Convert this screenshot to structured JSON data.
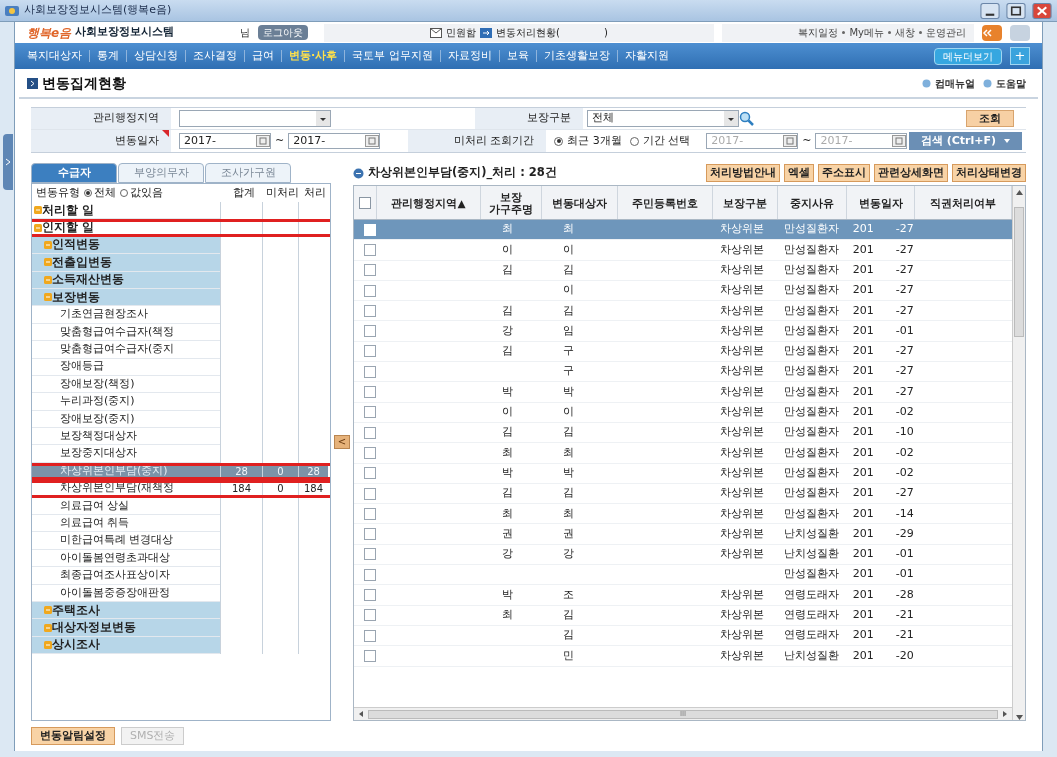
{
  "window": {
    "title": "사회보장정보시스템(행복e음)"
  },
  "header": {
    "logo_mark": "행복e음",
    "logo_text": "사회보장정보시스템",
    "user_suffix": "님",
    "logout": "로그아웃",
    "inbox": "민원함",
    "status_prefix": "변동처리현황(",
    "status_suffix": ")",
    "links": [
      "복지일정",
      "My메뉴",
      "새창",
      "운영관리"
    ]
  },
  "nav": {
    "items": [
      {
        "label": "복지대상자",
        "selected": false
      },
      {
        "label": "통계",
        "selected": false
      },
      {
        "label": "상담신청",
        "selected": false
      },
      {
        "label": "조사결정",
        "selected": false
      },
      {
        "label": "급여",
        "selected": false
      },
      {
        "label": "변동·사후",
        "selected": true
      },
      {
        "label": "국토부 업무지원",
        "selected": false
      },
      {
        "label": "자료정비",
        "selected": false
      },
      {
        "label": "보육",
        "selected": false
      },
      {
        "label": "기초생활보장",
        "selected": false
      },
      {
        "label": "자활지원",
        "selected": false
      }
    ],
    "more": "메뉴더보기",
    "plus": "+"
  },
  "page": {
    "title": "변동집계현황",
    "links": [
      "컴매뉴얼",
      "도움말"
    ]
  },
  "search": {
    "region_label": "관리행정지역",
    "type_label": "보장구분",
    "type_value": "전체",
    "query_button": "조회",
    "date_label": "변동일자",
    "date_from": "2017-",
    "date_tilde": "~",
    "date_to": "2017-",
    "period_label": "미처리 조회기간",
    "period_options": [
      {
        "label": "최근 3개월",
        "selected": true
      },
      {
        "label": "기간 선택",
        "selected": false
      }
    ],
    "period_from": "2017-",
    "period_to": "2017-",
    "find_button": "검색 (Ctrl+F)"
  },
  "tabs": [
    {
      "label": "수급자",
      "selected": true
    },
    {
      "label": "부양의무자",
      "selected": false
    },
    {
      "label": "조사가구원",
      "selected": false
    }
  ],
  "tree": {
    "filter_label": "변동유형",
    "filter_options": [
      {
        "label": "전체",
        "selected": true
      },
      {
        "label": "값있음",
        "selected": false
      }
    ],
    "columns": [
      "합계",
      "미처리",
      "처리"
    ],
    "items": [
      {
        "label": "처리할 일",
        "kind": "group",
        "highlighted": false
      },
      {
        "label": "인지할 일",
        "kind": "group",
        "highlighted": true,
        "children": [
          {
            "label": "인적변동",
            "kind": "group",
            "highlighted": false
          },
          {
            "label": "전출입변동",
            "kind": "group",
            "highlighted": false
          },
          {
            "label": "소득재산변동",
            "kind": "group",
            "highlighted": false
          },
          {
            "label": "보장변동",
            "kind": "group",
            "highlighted": false,
            "children": [
              {
                "label": "기초연금현장조사",
                "kind": "leaf",
                "selected": false,
                "highlighted": false
              },
              {
                "label": "맞춤형급여수급자(책정",
                "kind": "leaf",
                "selected": false,
                "highlighted": false
              },
              {
                "label": "맞춤형급여수급자(중지",
                "kind": "leaf",
                "selected": false,
                "highlighted": false
              },
              {
                "label": "장애등급",
                "kind": "leaf",
                "selected": false,
                "highlighted": false
              },
              {
                "label": "장애보장(책정)",
                "kind": "leaf",
                "selected": false,
                "highlighted": false
              },
              {
                "label": "누리과정(중지)",
                "kind": "leaf",
                "selected": false,
                "highlighted": false
              },
              {
                "label": "장애보장(중지)",
                "kind": "leaf",
                "selected": false,
                "highlighted": false
              },
              {
                "label": "보장책정대상자",
                "kind": "leaf",
                "selected": false,
                "highlighted": false
              },
              {
                "label": "보장중지대상자",
                "kind": "leaf",
                "selected": false,
                "highlighted": false
              },
              {
                "label": "차상위본인부담(중지)",
                "kind": "leaf",
                "selected": true,
                "highlighted": true,
                "total": "28",
                "pending": "0",
                "done": "28"
              },
              {
                "label": "차상위본인부담(재책정",
                "kind": "leaf",
                "selected": false,
                "highlighted": true,
                "total": "184",
                "pending": "0",
                "done": "184"
              },
              {
                "label": "의료급여 상실",
                "kind": "leaf",
                "selected": false,
                "highlighted": false
              },
              {
                "label": "의료급여 취득",
                "kind": "leaf",
                "selected": false,
                "highlighted": false
              },
              {
                "label": "미한급여특례 변경대상",
                "kind": "leaf",
                "selected": false,
                "highlighted": false
              },
              {
                "label": "아이돌봄연령초과대상",
                "kind": "leaf",
                "selected": false,
                "highlighted": false
              },
              {
                "label": "최종급여조사표상이자",
                "kind": "leaf",
                "selected": false,
                "highlighted": false
              },
              {
                "label": "아이돌봄중증장애판정",
                "kind": "leaf",
                "selected": false,
                "highlighted": false
              }
            ]
          },
          {
            "label": "주택조사",
            "kind": "group",
            "highlighted": false
          },
          {
            "label": "대상자정보변동",
            "kind": "group",
            "highlighted": false
          },
          {
            "label": "상시조사",
            "kind": "group",
            "highlighted": false
          }
        ]
      }
    ]
  },
  "collapse_button": "<",
  "grid": {
    "title": "차상위본인부담(중지)_처리 : 28건",
    "buttons": [
      "처리방법안내",
      "엑셀",
      "주소표시",
      "관련상세화면",
      "처리상태변경"
    ],
    "select_all": {
      "checked": false
    },
    "columns": [
      "관리행정지역▲",
      "보장\n가구주명",
      "변동대상자",
      "주민등록번호",
      "보장구분",
      "중지사유",
      "변동일자",
      "직권처리여부"
    ],
    "rows": [
      {
        "selected": true,
        "head": "최",
        "target": "최",
        "type": "차상위본",
        "reason": "만성질환자",
        "year": "201",
        "day": "-27"
      },
      {
        "selected": false,
        "head": "이",
        "target": "이",
        "type": "차상위본",
        "reason": "만성질환자",
        "year": "201",
        "day": "-27"
      },
      {
        "selected": false,
        "head": "김",
        "target": "김",
        "type": "차상위본",
        "reason": "만성질환자",
        "year": "201",
        "day": "-27"
      },
      {
        "selected": false,
        "target": "이",
        "type": "차상위본",
        "reason": "만성질환자",
        "year": "201",
        "day": "-27"
      },
      {
        "selected": false,
        "head": "김",
        "target": "김",
        "type": "차상위본",
        "reason": "만성질환자",
        "year": "201",
        "day": "-27"
      },
      {
        "selected": false,
        "head": "강",
        "target": "임",
        "type": "차상위본",
        "reason": "만성질환자",
        "year": "201",
        "day": "-01"
      },
      {
        "selected": false,
        "head": "김",
        "target": "구",
        "type": "차상위본",
        "reason": "만성질환자",
        "year": "201",
        "day": "-27"
      },
      {
        "selected": false,
        "target": "구",
        "type": "차상위본",
        "reason": "만성질환자",
        "year": "201",
        "day": "-27"
      },
      {
        "selected": false,
        "head": "박",
        "target": "박",
        "type": "차상위본",
        "reason": "만성질환자",
        "year": "201",
        "day": "-27"
      },
      {
        "selected": false,
        "head": "이",
        "target": "이",
        "type": "차상위본",
        "reason": "만성질환자",
        "year": "201",
        "day": "-02"
      },
      {
        "selected": false,
        "head": "김",
        "target": "김",
        "type": "차상위본",
        "reason": "만성질환자",
        "year": "201",
        "day": "-10"
      },
      {
        "selected": false,
        "head": "최",
        "target": "최",
        "type": "차상위본",
        "reason": "만성질환자",
        "year": "201",
        "day": "-02"
      },
      {
        "selected": false,
        "head": "박",
        "target": "박",
        "type": "차상위본",
        "reason": "만성질환자",
        "year": "201",
        "day": "-02"
      },
      {
        "selected": false,
        "head": "김",
        "target": "김",
        "type": "차상위본",
        "reason": "만성질환자",
        "year": "201",
        "day": "-27"
      },
      {
        "selected": false,
        "head": "최",
        "target": "최",
        "type": "차상위본",
        "reason": "만성질환자",
        "year": "201",
        "day": "-14"
      },
      {
        "selected": false,
        "head": "권",
        "target": "권",
        "type": "차상위본",
        "reason": "난치성질환",
        "year": "201",
        "day": "-29"
      },
      {
        "selected": false,
        "head": "강",
        "target": "강",
        "type": "차상위본",
        "reason": "난치성질환",
        "year": "201",
        "day": "-01"
      },
      {
        "selected": false,
        "reason": "만성질환자",
        "year": "201",
        "day": "-01"
      },
      {
        "selected": false,
        "head": "박",
        "target": "조",
        "type": "차상위본",
        "reason": "연령도래자",
        "year": "201",
        "day": "-28"
      },
      {
        "selected": false,
        "head": "최",
        "target": "김",
        "type": "차상위본",
        "reason": "연령도래자",
        "year": "201",
        "day": "-21"
      },
      {
        "selected": false,
        "target": "김",
        "type": "차상위본",
        "reason": "연령도래자",
        "year": "201",
        "day": "-21"
      },
      {
        "selected": false,
        "target": "민",
        "type": "차상위본",
        "reason": "난치성질환",
        "year": "201",
        "day": "-20"
      }
    ],
    "scroll_text": "III"
  },
  "footer": {
    "buttons": [
      {
        "label": "변동알림설정",
        "disabled": false
      },
      {
        "label": "SMS전송",
        "disabled": true
      }
    ]
  }
}
